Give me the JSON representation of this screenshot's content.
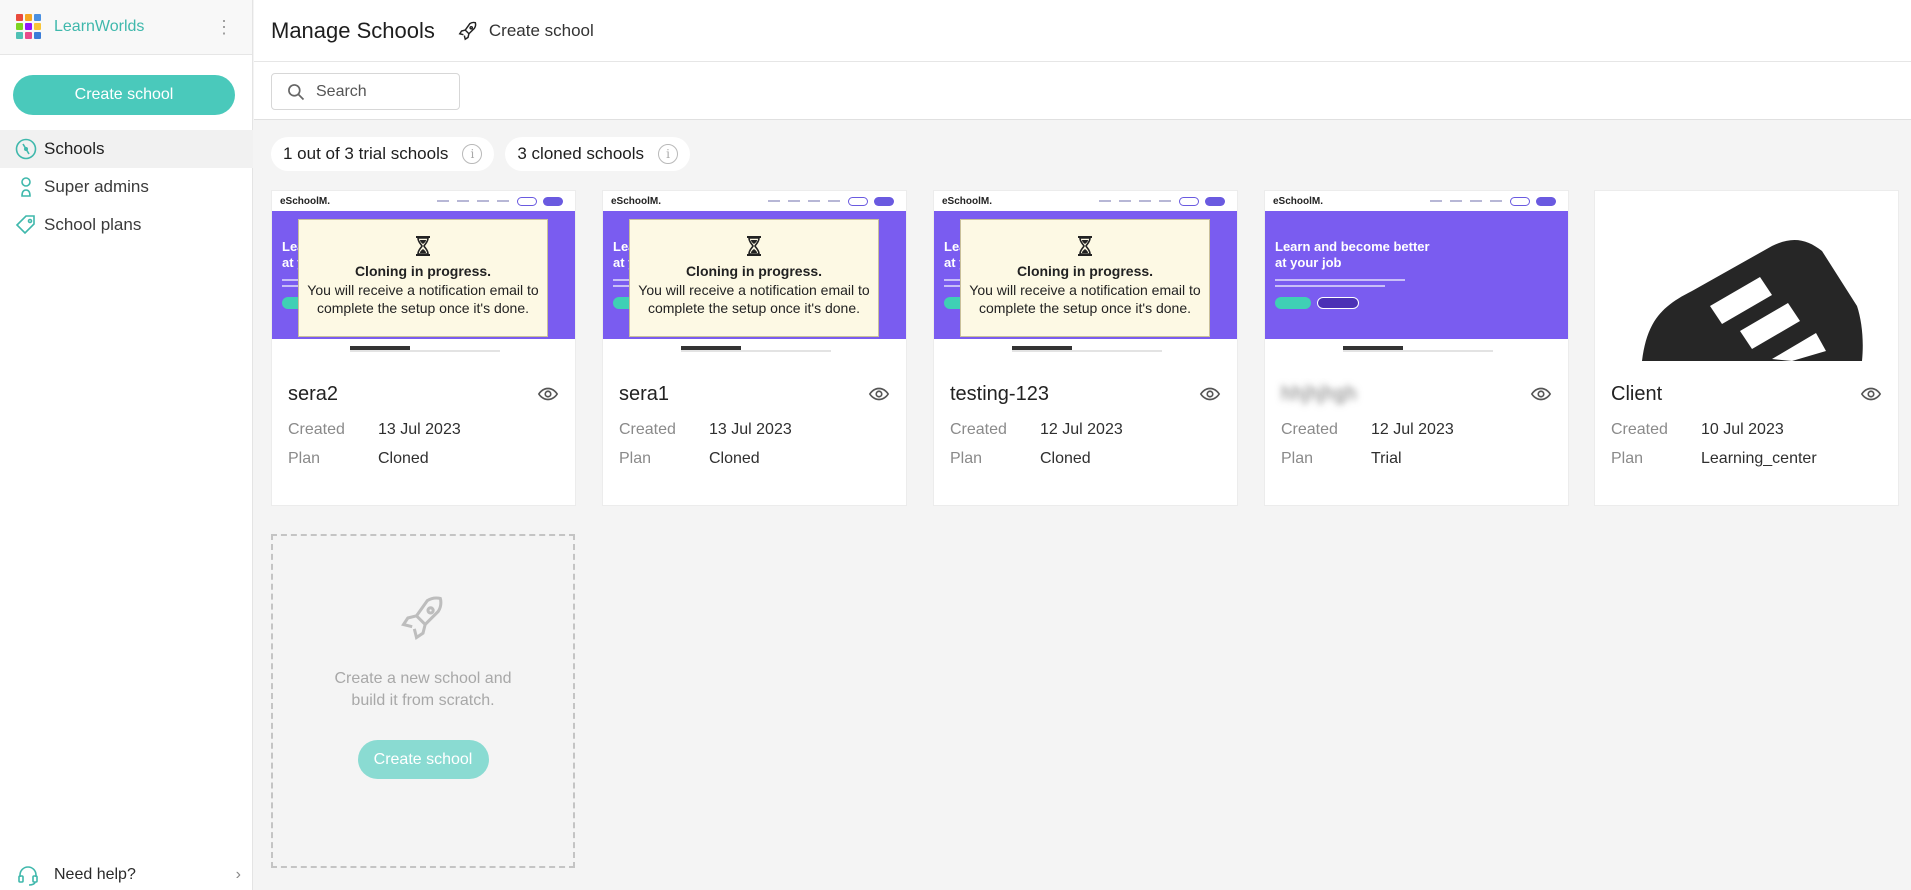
{
  "sidebar": {
    "brand": "LearnWorlds",
    "create_button": "Create school",
    "nav": [
      {
        "label": "Schools",
        "icon": "compass-icon",
        "active": true
      },
      {
        "label": "Super admins",
        "icon": "admin-user-icon",
        "active": false
      },
      {
        "label": "School plans",
        "icon": "price-tag-icon",
        "active": false
      }
    ],
    "help": "Need help?"
  },
  "header": {
    "title": "Manage Schools",
    "create_link": "Create school"
  },
  "search": {
    "placeholder": "Search",
    "value": ""
  },
  "chips": {
    "trial": "1 out of 3 trial schools",
    "cloned": "3 cloned schools"
  },
  "thumbnail": {
    "site_logo": "eSchoolM.",
    "hero_title": "Learn and become better at your job"
  },
  "cloning": {
    "title": "Cloning in progress.",
    "line1": "You will receive a notification email to",
    "line2": "complete the setup once it's done."
  },
  "labels": {
    "created": "Created",
    "plan": "Plan"
  },
  "schools": [
    {
      "name": "sera2",
      "created": "13 Jul 2023",
      "plan": "Cloned",
      "status": "cloning"
    },
    {
      "name": "sera1",
      "created": "13 Jul 2023",
      "plan": "Cloned",
      "status": "cloning"
    },
    {
      "name": "testing-123",
      "created": "12 Jul 2023",
      "plan": "Cloned",
      "status": "cloning"
    },
    {
      "name": "hhjhjhgh",
      "created": "12 Jul 2023",
      "plan": "Trial",
      "status": "blurred"
    },
    {
      "name": "Client",
      "created": "10 Jul 2023",
      "plan": "Learning_center",
      "status": "logo"
    }
  ],
  "new_school": {
    "text_line1": "Create a new school and",
    "text_line2": "build it from scratch.",
    "button": "Create school"
  },
  "colors": {
    "accent": "#4ac9bb",
    "hero_purple": "#7a5cf0",
    "cloning_bg": "#fdf9e4"
  }
}
